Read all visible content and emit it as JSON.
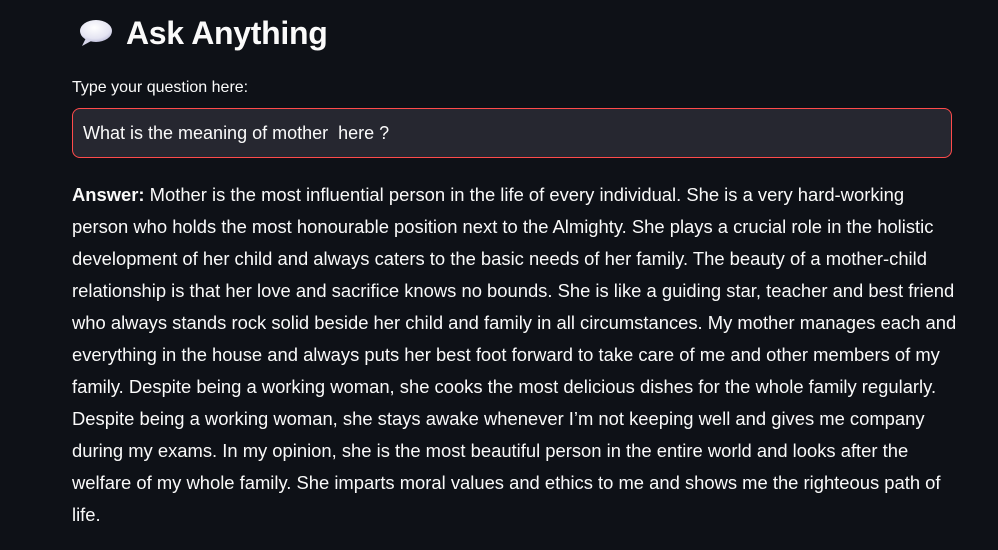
{
  "header": {
    "icon": "speech-balloon-icon",
    "title": "Ask Anything"
  },
  "question": {
    "label": "Type your question here:",
    "value": "What is the meaning of mother  here ?"
  },
  "answer": {
    "label": "Answer:",
    "text": " Mother is the most influential person in the life of every individual. She is a very hard-working person who holds the most honourable position next to the Almighty. She plays a crucial role in the holistic development of her child and always caters to the basic needs of her family. The beauty of a mother-child relationship is that her love and sacrifice knows no bounds. She is like a guiding star, teacher and best friend who always stands rock solid beside her child and family in all circumstances. My mother manages each and everything in the house and always puts her best foot forward to take care of me and other members of my family. Despite being a working woman, she cooks the most delicious dishes for the whole family regularly. Despite being a working woman, she stays awake whenever I’m not keeping well and gives me company during my exams. In my opinion, she is the most beautiful person in the entire world and looks after the welfare of my whole family. She imparts moral values and ethics to me and shows me the righteous path of life."
  },
  "colors": {
    "background": "#0e1117",
    "input_background": "#262730",
    "input_border_focus": "#ff4b4b",
    "text": "#fafafa"
  }
}
